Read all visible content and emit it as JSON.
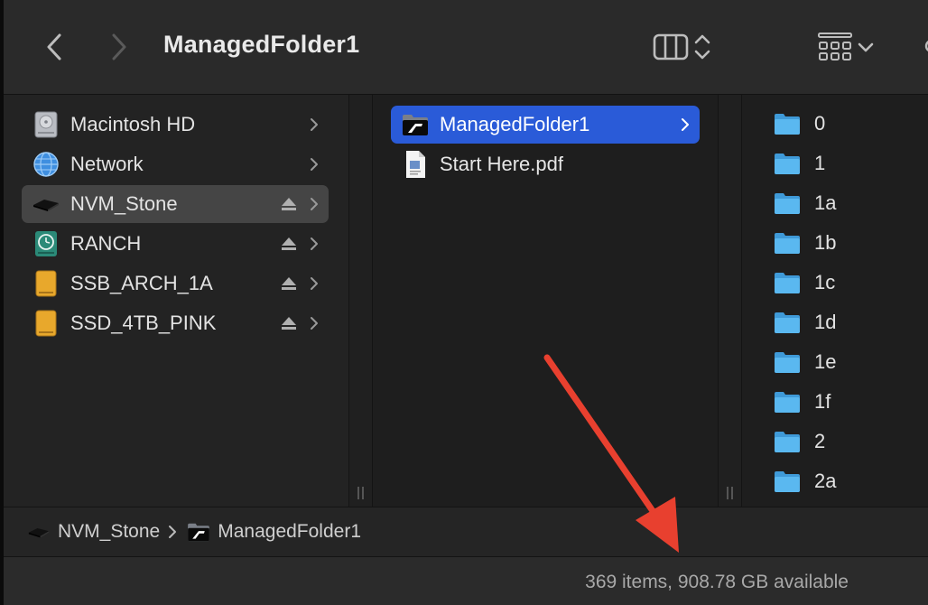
{
  "window": {
    "title": "ManagedFolder1"
  },
  "toolbar": {
    "back": "back",
    "forward": "forward"
  },
  "sidebar": {
    "items": [
      {
        "label": "Macintosh HD",
        "icon": "internal-drive-icon",
        "eject": false
      },
      {
        "label": "Network",
        "icon": "network-globe-icon",
        "eject": false
      },
      {
        "label": "NVM_Stone",
        "icon": "external-ssd-icon",
        "eject": true,
        "selected": true
      },
      {
        "label": "RANCH",
        "icon": "time-machine-drive-icon",
        "eject": true
      },
      {
        "label": "SSB_ARCH_1A",
        "icon": "external-drive-icon",
        "eject": true
      },
      {
        "label": "SSD_4TB_PINK",
        "icon": "external-drive-icon",
        "eject": true
      }
    ]
  },
  "column2": {
    "items": [
      {
        "label": "ManagedFolder1",
        "icon": "managed-folder-icon",
        "active": true
      },
      {
        "label": "Start Here.pdf",
        "icon": "pdf-document-icon",
        "active": false
      }
    ]
  },
  "column3": {
    "items": [
      {
        "label": "0"
      },
      {
        "label": "1"
      },
      {
        "label": "1a"
      },
      {
        "label": "1b"
      },
      {
        "label": "1c"
      },
      {
        "label": "1d"
      },
      {
        "label": "1e"
      },
      {
        "label": "1f"
      },
      {
        "label": "2"
      },
      {
        "label": "2a"
      }
    ]
  },
  "pathbar": {
    "segments": [
      {
        "label": "NVM_Stone",
        "icon": "external-ssd-icon"
      },
      {
        "label": "ManagedFolder1",
        "icon": "managed-folder-icon"
      }
    ]
  },
  "status": {
    "text": "369 items, 908.78 GB available"
  },
  "colors": {
    "accent": "#2a5bd8",
    "folder": "#5ab8f0",
    "annotation": "#e8402f"
  }
}
